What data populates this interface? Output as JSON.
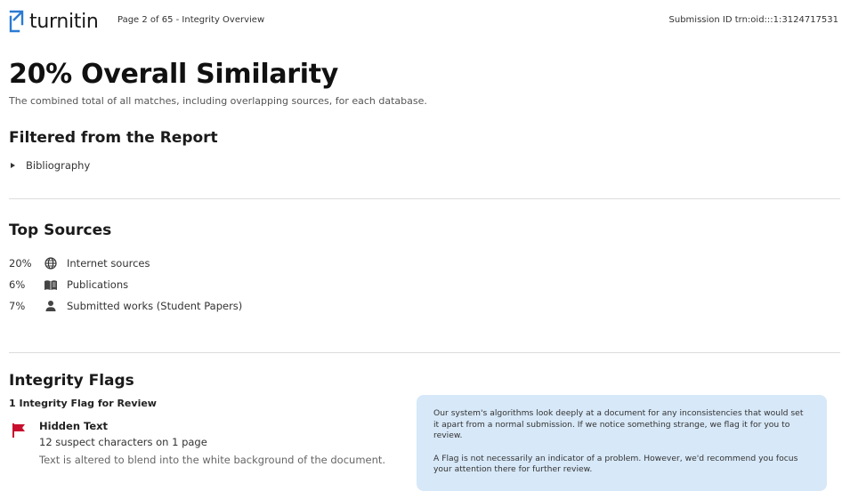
{
  "header": {
    "logo_text": "turnitin",
    "page_info": "Page 2 of 65 - Integrity Overview",
    "submission_id": "Submission ID trn:oid:::1:3124717531"
  },
  "overview": {
    "title": "20% Overall Similarity",
    "subtitle": "The combined total of all matches, including overlapping sources, for each database."
  },
  "filtered": {
    "heading": "Filtered from the Report",
    "items": [
      {
        "label": "Bibliography"
      }
    ]
  },
  "top_sources": {
    "heading": "Top Sources",
    "rows": [
      {
        "percent": "20%",
        "icon": "globe-icon",
        "label": "Internet sources"
      },
      {
        "percent": "6%",
        "icon": "book-icon",
        "label": "Publications"
      },
      {
        "percent": "7%",
        "icon": "person-icon",
        "label": "Submitted works (Student Papers)"
      }
    ]
  },
  "integrity_flags": {
    "heading": "Integrity Flags",
    "count_text": "1 Integrity Flag for Review",
    "flags": [
      {
        "icon": "flag-icon",
        "title": "Hidden Text",
        "subtitle": "12 suspect characters on 1 page",
        "description": "Text is altered to blend into the white background of the document."
      }
    ],
    "info": {
      "paragraph1": "Our system's algorithms look deeply at a document for any inconsistencies that would set it apart from a normal submission. If we notice something strange, we flag it for you to review.",
      "paragraph2": "A Flag is not necessarily an indicator of a problem. However, we'd recommend you focus your attention there for further review."
    }
  },
  "colors": {
    "brand_blue": "#2a7bd3",
    "flag_red": "#c8102e",
    "info_bg": "#d7e8f8"
  }
}
